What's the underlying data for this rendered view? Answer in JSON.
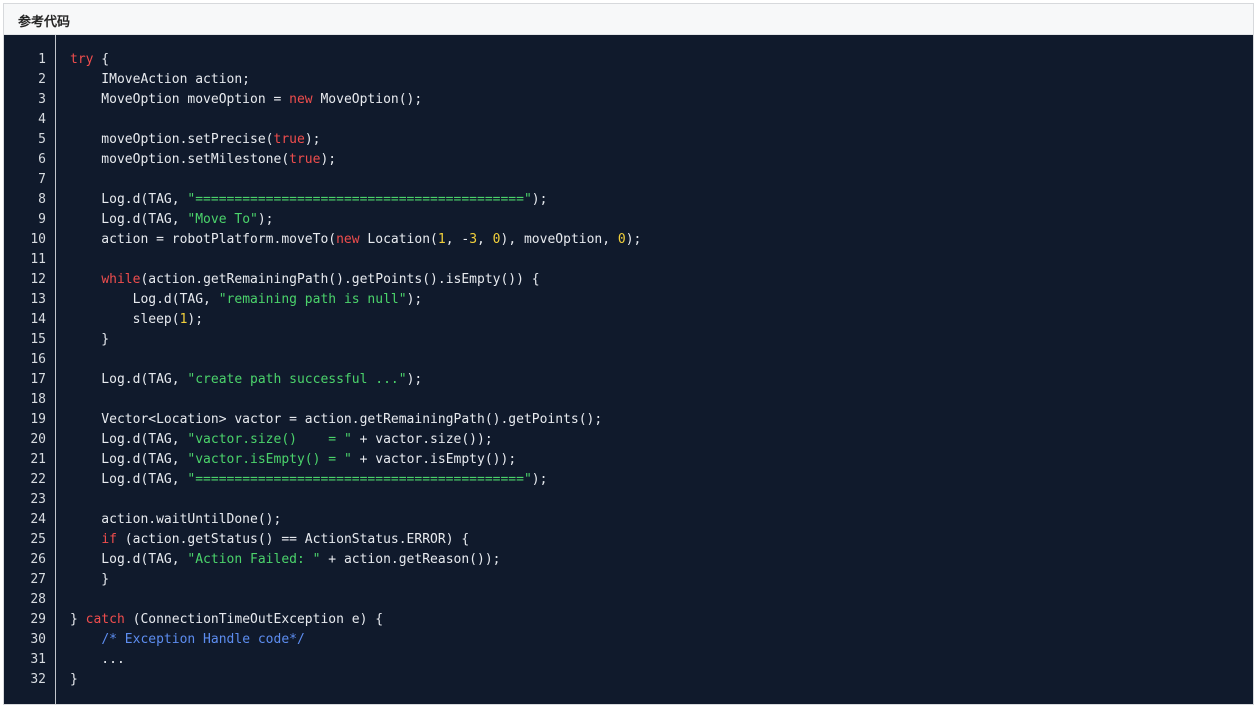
{
  "header": {
    "title": "参考代码"
  },
  "colors": {
    "background": "#101a2c",
    "keyword": "#ef4d4d",
    "string": "#4bd36b",
    "number": "#f2d03b",
    "comment": "#5d8df0",
    "text": "#e7eaef"
  },
  "code": {
    "lines": [
      [
        [
          "kw",
          "try"
        ],
        [
          "p",
          " {"
        ]
      ],
      [
        [
          "p",
          "    IMoveAction action;"
        ]
      ],
      [
        [
          "p",
          "    MoveOption moveOption = "
        ],
        [
          "kw",
          "new"
        ],
        [
          "p",
          " MoveOption();"
        ]
      ],
      [],
      [
        [
          "p",
          "    moveOption.setPrecise("
        ],
        [
          "kw",
          "true"
        ],
        [
          "p",
          ");"
        ]
      ],
      [
        [
          "p",
          "    moveOption.setMilestone("
        ],
        [
          "kw",
          "true"
        ],
        [
          "p",
          ");"
        ]
      ],
      [],
      [
        [
          "p",
          "    Log.d(TAG, "
        ],
        [
          "str",
          "\"==========================================\""
        ],
        [
          "p",
          ");"
        ]
      ],
      [
        [
          "p",
          "    Log.d(TAG, "
        ],
        [
          "str",
          "\"Move To\""
        ],
        [
          "p",
          ");"
        ]
      ],
      [
        [
          "p",
          "    action = robotPlatform.moveTo("
        ],
        [
          "kw",
          "new"
        ],
        [
          "p",
          " Location("
        ],
        [
          "num",
          "1"
        ],
        [
          "p",
          ", -"
        ],
        [
          "num",
          "3"
        ],
        [
          "p",
          ", "
        ],
        [
          "num",
          "0"
        ],
        [
          "p",
          "), moveOption, "
        ],
        [
          "num",
          "0"
        ],
        [
          "p",
          ");"
        ]
      ],
      [],
      [
        [
          "p",
          "    "
        ],
        [
          "kw",
          "while"
        ],
        [
          "p",
          "(action.getRemainingPath().getPoints().isEmpty()) {"
        ]
      ],
      [
        [
          "p",
          "        Log.d(TAG, "
        ],
        [
          "str",
          "\"remaining path is null\""
        ],
        [
          "p",
          ");"
        ]
      ],
      [
        [
          "p",
          "        sleep("
        ],
        [
          "num",
          "1"
        ],
        [
          "p",
          ");"
        ]
      ],
      [
        [
          "p",
          "    }"
        ]
      ],
      [],
      [
        [
          "p",
          "    Log.d(TAG, "
        ],
        [
          "str",
          "\"create path successful ...\""
        ],
        [
          "p",
          ");"
        ]
      ],
      [],
      [
        [
          "p",
          "    Vector<Location> vactor = action.getRemainingPath().getPoints();"
        ]
      ],
      [
        [
          "p",
          "    Log.d(TAG, "
        ],
        [
          "str",
          "\"vactor.size()    = \""
        ],
        [
          "p",
          " + vactor.size());"
        ]
      ],
      [
        [
          "p",
          "    Log.d(TAG, "
        ],
        [
          "str",
          "\"vactor.isEmpty() = \""
        ],
        [
          "p",
          " + vactor.isEmpty());"
        ]
      ],
      [
        [
          "p",
          "    Log.d(TAG, "
        ],
        [
          "str",
          "\"==========================================\""
        ],
        [
          "p",
          ");"
        ]
      ],
      [],
      [
        [
          "p",
          "    action.waitUntilDone();"
        ]
      ],
      [
        [
          "p",
          "    "
        ],
        [
          "kw",
          "if"
        ],
        [
          "p",
          " (action.getStatus() == ActionStatus.ERROR) {"
        ]
      ],
      [
        [
          "p",
          "    Log.d(TAG, "
        ],
        [
          "str",
          "\"Action Failed: \""
        ],
        [
          "p",
          " + action.getReason());"
        ]
      ],
      [
        [
          "p",
          "    }"
        ]
      ],
      [],
      [
        [
          "p",
          "} "
        ],
        [
          "kw",
          "catch"
        ],
        [
          "p",
          " (ConnectionTimeOutException e) {"
        ]
      ],
      [
        [
          "p",
          "    "
        ],
        [
          "cm",
          "/* Exception Handle code*/"
        ]
      ],
      [
        [
          "p",
          "    ..."
        ]
      ],
      [
        [
          "p",
          "}"
        ]
      ]
    ]
  }
}
